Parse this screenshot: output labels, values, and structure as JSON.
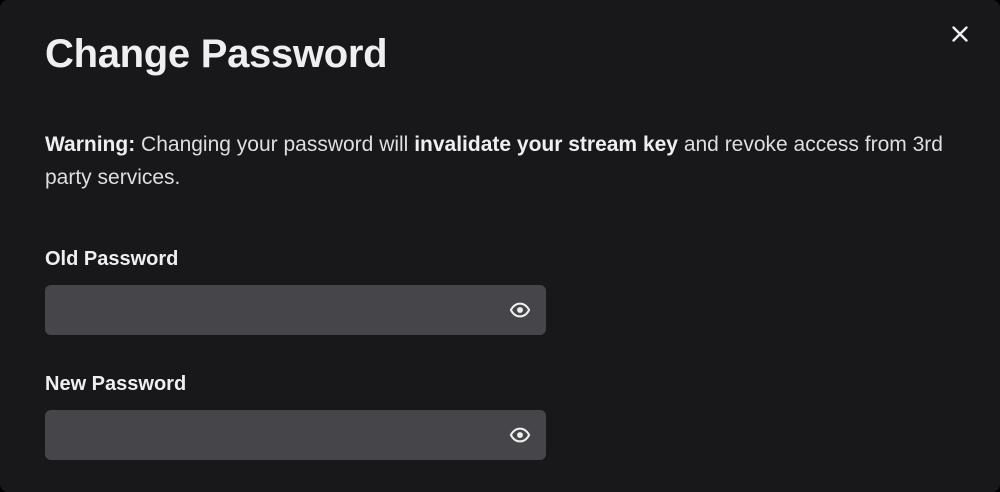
{
  "dialog": {
    "title": "Change Password",
    "close_icon": "close-icon"
  },
  "warning": {
    "lead": "Warning:",
    "text_1": " Changing your password will ",
    "emphasis": "invalidate your stream key",
    "text_2": " and revoke access from 3rd party services."
  },
  "old_password": {
    "label": "Old Password",
    "value": "",
    "placeholder": "",
    "toggle_icon": "eye-icon"
  },
  "new_password": {
    "label": "New Password",
    "value": "",
    "placeholder": "",
    "toggle_icon": "eye-icon"
  },
  "colors": {
    "background": "#18181b",
    "input_background": "#46464a",
    "text": "#efeff1"
  }
}
